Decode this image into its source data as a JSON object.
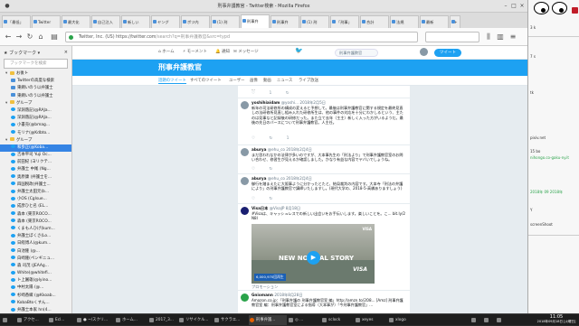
{
  "window": {
    "title": "刑事弁護教官 - Twitter検索 - Mozilla Firefox"
  },
  "tabs": [
    {
      "label": "「最低」"
    },
    {
      "label": "Twitter"
    },
    {
      "label": "最大化"
    },
    {
      "label": "自己注入"
    },
    {
      "label": "新しい"
    },
    {
      "label": "ヤング"
    },
    {
      "label": "ボツ内"
    },
    {
      "label": "(1) 刑"
    },
    {
      "label": "刑事弁"
    },
    {
      "label": "刑事弁"
    },
    {
      "label": "(1) 刑"
    },
    {
      "label": "「刑事」"
    },
    {
      "label": "合計"
    },
    {
      "label": "法規"
    },
    {
      "label": "最新"
    }
  ],
  "url": {
    "site": "Twitter, Inc. (US)",
    "host": "https://twitter.com",
    "path": "/search?q=刑事弁護教官&src=typd"
  },
  "sidebar": {
    "title": "ブックマーク",
    "search_placeholder": "ブックマークを検索",
    "items": [
      {
        "label": "お後ト",
        "type": "folder",
        "indent": 1,
        "open": true
      },
      {
        "label": "Twitterの高度な検索",
        "type": "page",
        "indent": 2
      },
      {
        "label": "東網いのう以弁護士",
        "type": "page",
        "indent": 2
      },
      {
        "label": "東網いのう以弁護士",
        "type": "page",
        "indent": 2
      },
      {
        "label": "グループ",
        "type": "folder",
        "indent": 1,
        "open": true
      },
      {
        "label": "深淵落記(@RAJa...",
        "type": "tw",
        "indent": 2
      },
      {
        "label": "深淵落記(@RAJa...",
        "type": "tw",
        "indent": 2
      },
      {
        "label": "小書売(@bmag...",
        "type": "tw",
        "indent": 2
      },
      {
        "label": "モリナ(@Kdbto...",
        "type": "tw",
        "indent": 2
      },
      {
        "label": "グループ",
        "type": "folder",
        "indent": 1,
        "open": true
      },
      {
        "label": "和歩正(@Koba...",
        "type": "tw",
        "indent": 2,
        "selected": true
      },
      {
        "label": "吉本平司 Yuji Oc...",
        "type": "tw",
        "indent": 2
      },
      {
        "label": "前田紀 (ヨリクテ...",
        "type": "tw",
        "indent": 2
      },
      {
        "label": "弁護士 中尾 (Ng...",
        "type": "tw",
        "indent": 2
      },
      {
        "label": "奥原康 (弁護士を...",
        "type": "tw",
        "indent": 2
      },
      {
        "label": "四国税政(弁護士...",
        "type": "tw",
        "indent": 2
      },
      {
        "label": "弁護士太田元(b...",
        "type": "tw",
        "indent": 2
      },
      {
        "label": "小OS (Cglsue...",
        "type": "tw",
        "indent": 2
      },
      {
        "label": "成彦ひと名 (EL...",
        "type": "tw",
        "indent": 2
      },
      {
        "label": "森本 (東京ROCO...",
        "type": "tw",
        "indent": 2
      },
      {
        "label": "森本 (東京ROCO...",
        "type": "tw",
        "indent": 2
      },
      {
        "label": "くまも人ひげ(kum...",
        "type": "tw",
        "indent": 2
      },
      {
        "label": "弁護士ぼくさ(Lo...",
        "type": "tw",
        "indent": 2
      },
      {
        "label": "日経博人(@kum...",
        "type": "tw",
        "indent": 2
      },
      {
        "label": "白池隆 (@...",
        "type": "tw",
        "indent": 2
      },
      {
        "label": "白崎隆(ペンギニュ...",
        "type": "tw",
        "indent": 2
      },
      {
        "label": "森 司茂 (JEAAg...",
        "type": "tw",
        "indent": 2
      },
      {
        "label": "White(@whitefi...",
        "type": "tw",
        "indent": 2
      },
      {
        "label": "ト上園雄(@lyino...",
        "type": "tw",
        "indent": 2
      },
      {
        "label": "中村太陽 (@...",
        "type": "tw",
        "indent": 2
      },
      {
        "label": "杉崎香織 (@Kkoab...",
        "type": "tw",
        "indent": 2
      },
      {
        "label": "KobaBtoくすん...",
        "type": "tw",
        "indent": 2
      },
      {
        "label": "弁護士本家 hn(4...",
        "type": "tw",
        "indent": 2
      }
    ]
  },
  "twitter": {
    "nav": [
      "ホーム",
      "モーメント",
      "通知",
      "メッセージ"
    ],
    "search_placeholder": "刑事弁護教官",
    "tweet_button": "ツイート",
    "query": "刑事弁護教官",
    "tabs": [
      "話題のツイート",
      "すべてのツイート",
      "ユーザー",
      "画像",
      "動画",
      "ニュース",
      "ライブ放送"
    ],
    "tweets": [
      {
        "name": "",
        "handle": "",
        "text": "...",
        "actions": "♡ 1 ↻"
      },
      {
        "name": "yoshihiaidam",
        "handle": "@yoshi... 2018年2月5日",
        "text": "新年の司法研修所の構成の変えると予想して。最後は刑事弁護教官に関する規定を最終見直しの法研修所見直し組み入れた研修所生は、他の事件の対応を十分にわかしるという、主たのは見事なと記録後の研修だった。また立て去年（主主）新しく入った方がいるようだ。最後の先日のバースについて刑事弁護教官。人主任。",
        "actions": "♡ ↻ 1"
      },
      {
        "name": "aburya",
        "handle": "@ehu_co 2018年2月4日",
        "text": "まだ思われなかの法律が多いのですが、大本事先生の「刑法より」で刑事弁護教官室のお問い合わせ、修習生が見えるか確認しました。かなり有益な内容でヤバいでしょうね。",
        "actions": "♡ ↻"
      },
      {
        "name": "aburya",
        "handle": "@ehu_co 2018年2月4日",
        "text": "御行を踏まえたに大阪事ように分かったとたと、結局裁判の内容です。大本寺「刑法の弁護により」の刑事弁護教官で講師いたしますし。(現代大学の、2018-5-高橋ありますしょう)",
        "actions": "♡ ↻"
      },
      {
        "name": "Visa日本",
        "handle": "@VisaJP 8月18日",
        "text": "#Visaは、キャッシュレスでの新しい出会いをお手伝いします。楽しいことを。こ... bit.ly/2N8l",
        "actions": "",
        "media": {
          "title": "NEW NORMAL STORY",
          "logo": "VISA",
          "badge": "6,000,970回再生",
          "logo_bottom": "VISA"
        }
      },
      {
        "name": "プロモーション",
        "handle": "",
        "text": "",
        "actions": ""
      },
      {
        "name": "Gniomann",
        "handle": "2018年8月28日",
        "text": "Amazon.co.jp：「刑事弁護の 刑事弁護教官室 編」http://amzn.to/2O8... [Amz] 刑事弁護教官室 編：刑事弁護教官室による指導（大本事が）「今刑事弁護教官」…",
        "actions": ""
      }
    ]
  },
  "right_panel": {
    "rows": [
      "3 k",
      "7 s",
      "tk",
      "pixiv.net",
      "15 bo",
      "nihongo.co-gaku-ny.it",
      "2018年 09 2018年",
      "Y",
      "screenShoot"
    ]
  },
  "taskbar": {
    "items": [
      {
        "label": "アクセ..."
      },
      {
        "label": "Ecl..."
      },
      {
        "label": "● ~/スクリ..."
      },
      {
        "label": "ホーム..."
      },
      {
        "label": "2017_3..."
      },
      {
        "label": "リサイクル..."
      },
      {
        "label": "サクラエ..."
      },
      {
        "label": "刑事弁護..."
      },
      {
        "label": "◎ ..."
      },
      {
        "label": "sclock"
      },
      {
        "label": "xeyes"
      },
      {
        "label": "xlogo"
      }
    ],
    "clock_time": "11:05",
    "clock_date": "2018年09月18日 [火曜日]"
  }
}
